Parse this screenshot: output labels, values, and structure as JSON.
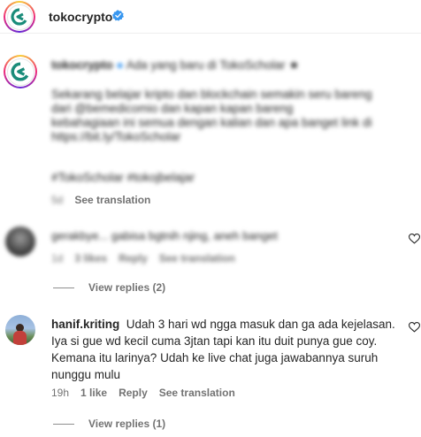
{
  "header": {
    "username": "tokocrypto",
    "verified_icon": "verified-badge-icon"
  },
  "post": {
    "username": "tokocrypto",
    "caption_line1": "Ada yang baru di TokoScholar",
    "caption_para": "Sekarang belajar kripto dan blockchain semakin seru bareng",
    "caption_para2": "dari @bemedicomio",
    "caption_para3": "dan kapan kapan bareng",
    "caption_para4": "kebahagiaan ini semua dengan kalian dan apa banget link di",
    "caption_para5": "https://bit.ly/TokoScholar",
    "hashtags": "#TokoScholar #tokojbelajar",
    "meta": {
      "time": "5d",
      "see_translation": "See translation"
    }
  },
  "comment1": {
    "text": "gerakbye... gabisa bgtnih njing, aneh banget",
    "meta": {
      "time": "1d",
      "likes": "3 likes",
      "reply": "Reply",
      "see_translation": "See translation"
    },
    "view_replies": "View replies (2)"
  },
  "comment2": {
    "username": "hanif.kriting",
    "text": "Udah 3 hari wd ngga masuk dan ga ada kejelasan. Iya si gue wd kecil cuma 3jtan tapi kan itu duit punya gue coy. Kemana itu larinya? Udah ke live chat juga jawabannya suruh nunggu mulu",
    "meta": {
      "time": "19h",
      "likes": "1 like",
      "reply": "Reply",
      "see_translation": "See translation"
    },
    "view_replies": "View replies (1)"
  },
  "colors": {
    "brand": "#1a8c7a",
    "verified": "#3897f0",
    "meta": "#737373"
  }
}
